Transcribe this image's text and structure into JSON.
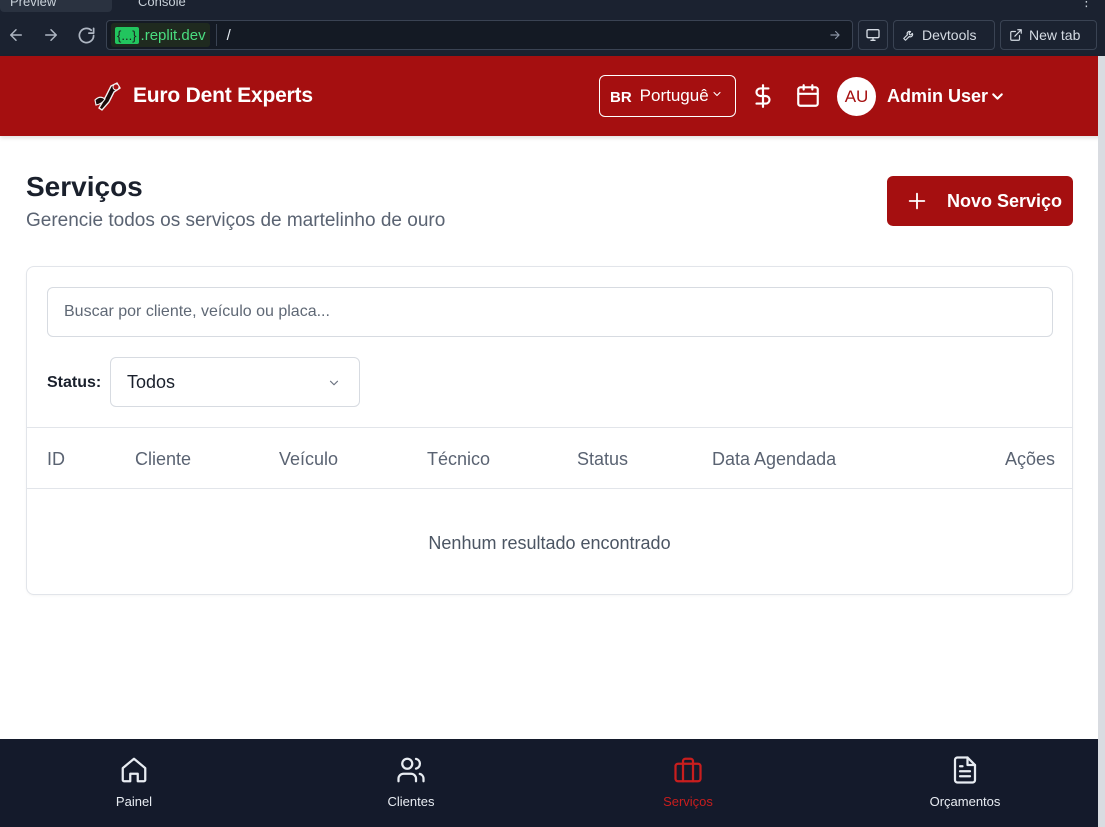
{
  "browser": {
    "tabs": [
      {
        "label": "Preview"
      },
      {
        "label": "Console"
      }
    ],
    "url_host_bracket": "{...}",
    "url_host_domain": ".replit.dev",
    "url_path": "/",
    "devtools_label": "Devtools",
    "newtab_label": "New tab"
  },
  "header": {
    "brand": "Euro Dent Experts",
    "language_code": "BR",
    "language_name": "Português",
    "avatar_initials": "AU",
    "user_name": "Admin User"
  },
  "page": {
    "title": "Serviços",
    "subtitle": "Gerencie todos os serviços de martelinho de ouro",
    "new_button": "Novo Serviço"
  },
  "filters": {
    "search_placeholder": "Buscar por cliente, veículo ou placa...",
    "status_label": "Status:",
    "status_value": "Todos"
  },
  "table": {
    "columns": [
      "ID",
      "Cliente",
      "Veículo",
      "Técnico",
      "Status",
      "Data Agendada",
      "Ações"
    ],
    "empty_message": "Nenhum resultado encontrado"
  },
  "bottom_nav": {
    "items": [
      {
        "label": "Painel",
        "icon": "home-icon"
      },
      {
        "label": "Clientes",
        "icon": "users-icon"
      },
      {
        "label": "Serviços",
        "icon": "briefcase-icon",
        "active": true
      },
      {
        "label": "Orçamentos",
        "icon": "document-icon"
      }
    ]
  },
  "colors": {
    "brand_red": "#a50f10",
    "active_nav": "#c81e1e",
    "nav_background": "#141a2b",
    "chrome_background": "#1b2230"
  }
}
